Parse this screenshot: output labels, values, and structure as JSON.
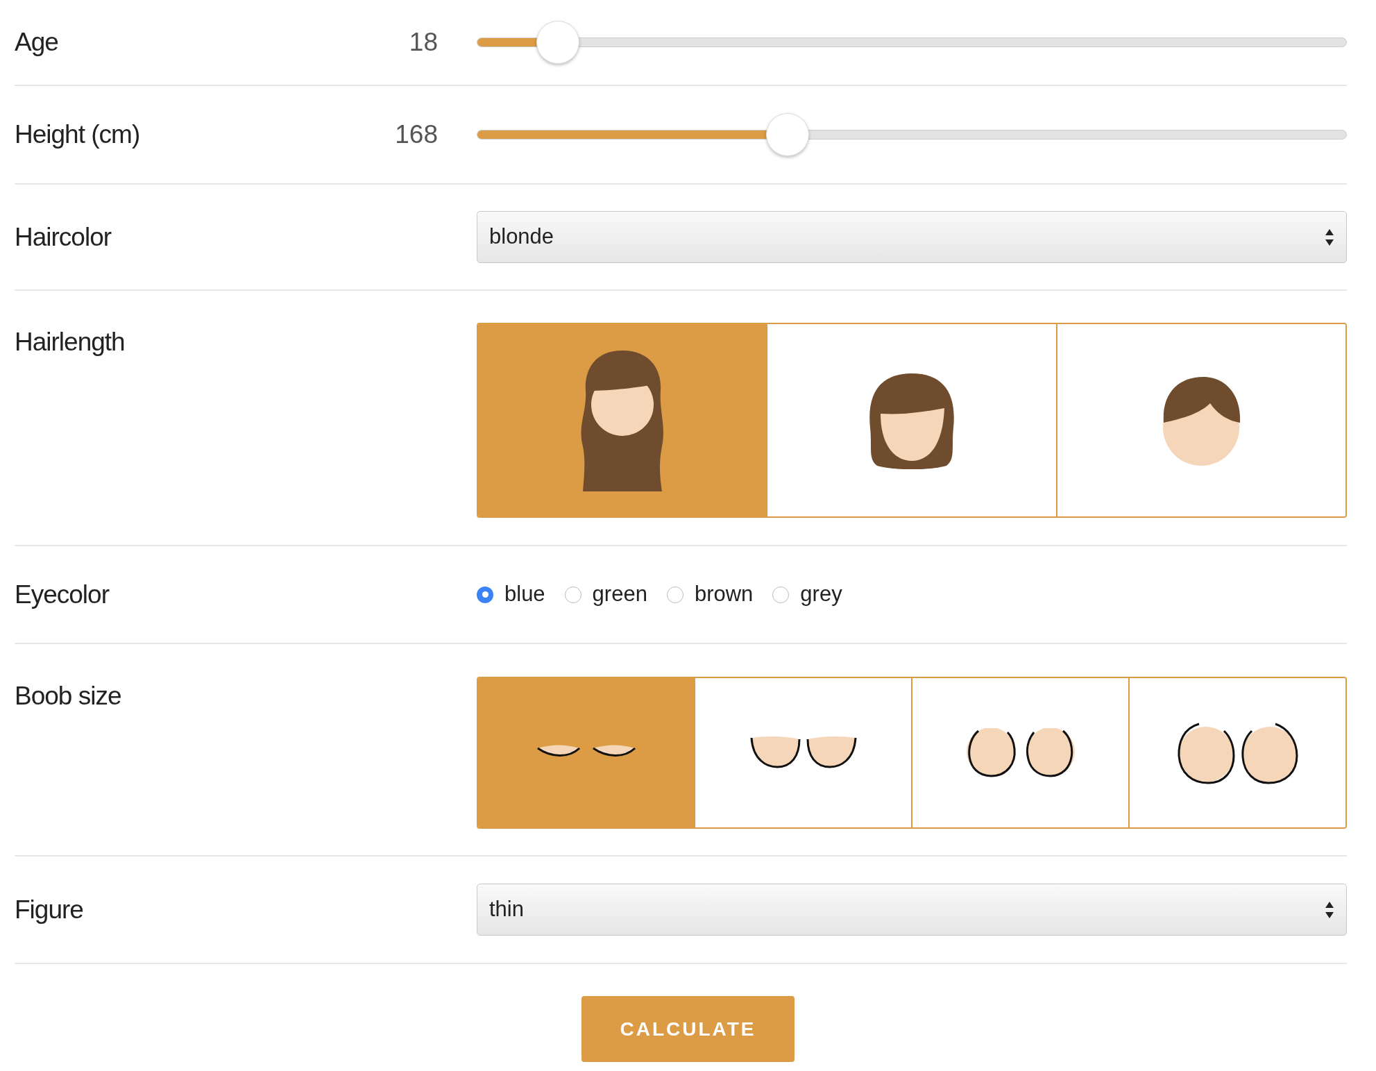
{
  "fields": [
    {
      "kind": "slider",
      "label": "Age",
      "value": "18",
      "level": 0.093
    },
    {
      "kind": "slider",
      "label": "Height (cm)",
      "value": "168",
      "level": 0.357
    },
    {
      "kind": "select",
      "label": "Haircolor",
      "value": "blonde"
    },
    {
      "kind": "tiles",
      "label": "Hairlength",
      "options": [
        {
          "kind": "long",
          "selected": true
        },
        {
          "kind": "medium",
          "selected": false
        },
        {
          "kind": "short",
          "selected": false
        }
      ]
    },
    {
      "kind": "radio",
      "label": "Eyecolor",
      "options": [
        {
          "label": "blue",
          "selected": true
        },
        {
          "label": "green",
          "selected": false
        },
        {
          "label": "brown",
          "selected": false
        },
        {
          "label": "grey",
          "selected": false
        }
      ]
    },
    {
      "kind": "tiles",
      "label": "Boob size",
      "options": [
        {
          "kind": "tiny",
          "selected": true
        },
        {
          "kind": "small",
          "selected": false
        },
        {
          "kind": "moderate",
          "selected": false
        },
        {
          "kind": "large",
          "selected": false
        }
      ]
    },
    {
      "kind": "select",
      "label": "Figure",
      "value": "thin"
    }
  ],
  "button": "CALCULATE"
}
